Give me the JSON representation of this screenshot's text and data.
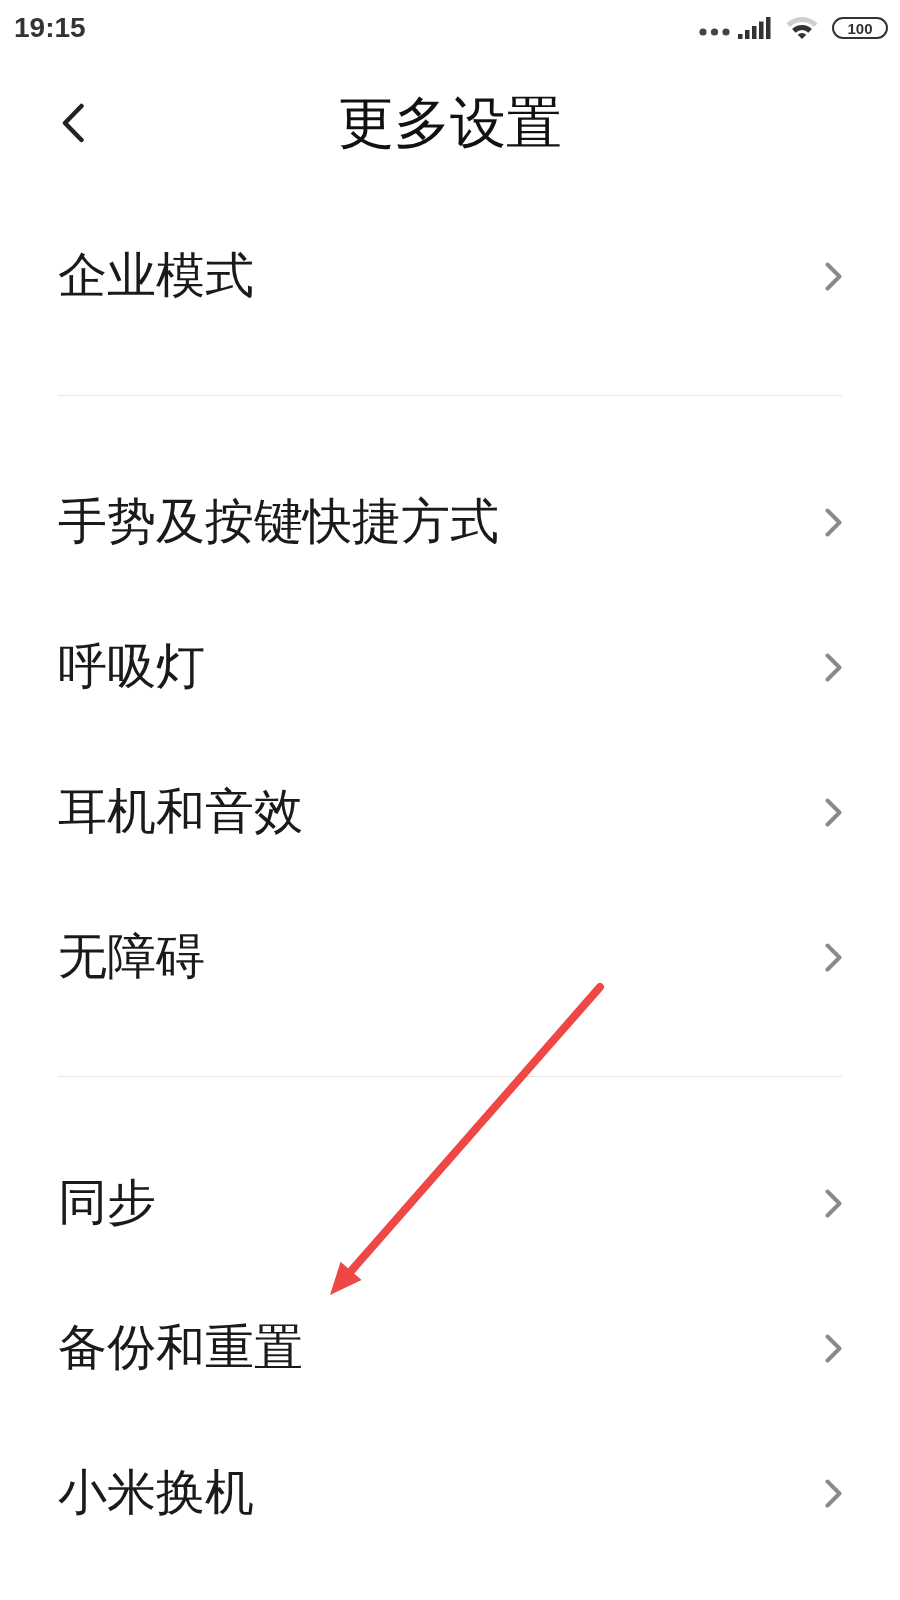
{
  "status_bar": {
    "time": "19:15",
    "battery": "100"
  },
  "header": {
    "title": "更多设置"
  },
  "sections": [
    {
      "items": [
        {
          "label": "企业模式"
        }
      ]
    },
    {
      "items": [
        {
          "label": "手势及按键快捷方式"
        },
        {
          "label": "呼吸灯"
        },
        {
          "label": "耳机和音效"
        },
        {
          "label": "无障碍"
        }
      ]
    },
    {
      "items": [
        {
          "label": "同步"
        },
        {
          "label": "备份和重置"
        },
        {
          "label": "小米换机"
        }
      ]
    }
  ]
}
